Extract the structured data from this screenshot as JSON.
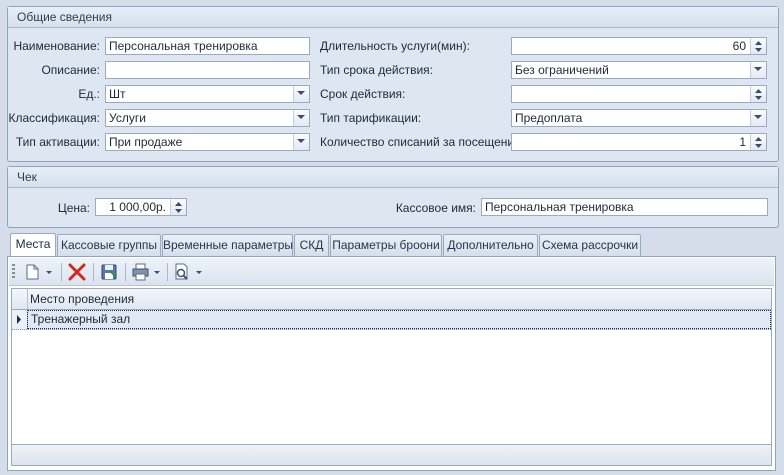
{
  "general": {
    "title": "Общие сведения",
    "name_label": "Наименование:",
    "name_value": "Персональная тренировка",
    "desc_label": "Описание:",
    "desc_value": "",
    "unit_label": "Ед.:",
    "unit_value": "Шт",
    "class_label": "Классификация:",
    "class_value": "Услуги",
    "activation_label": "Тип активации:",
    "activation_value": "При продаже",
    "duration_label": "Длительность услуги(мин):",
    "duration_value": "60",
    "term_type_label": "Тип срока действия:",
    "term_type_value": "Без ограничений",
    "term_label": "Срок действия:",
    "term_value": "",
    "tariff_label": "Тип тарификации:",
    "tariff_value": "Предоплата",
    "writeoff_label": "Количество списаний за посещение:",
    "writeoff_value": "1"
  },
  "receipt": {
    "title": "Чек",
    "price_label": "Цена:",
    "price_value": "1 000,00р.",
    "cashier_label": "Кассовое имя:",
    "cashier_value": "Персональная тренировка"
  },
  "tabs": [
    "Места",
    "Кассовые группы",
    "Временные параметры",
    "СКД",
    "Параметры броони",
    "Дополнительно",
    "Схема рассрочки"
  ],
  "grid": {
    "column": "Место проведения",
    "rows": [
      "Тренажерный зал"
    ]
  },
  "icons": [
    "new-document-icon",
    "delete-icon",
    "save-icon",
    "print-icon",
    "preview-icon"
  ],
  "colors": {
    "accent": "#d6e2f0",
    "border": "#8ea3c0",
    "delete": "#d22b1c"
  }
}
